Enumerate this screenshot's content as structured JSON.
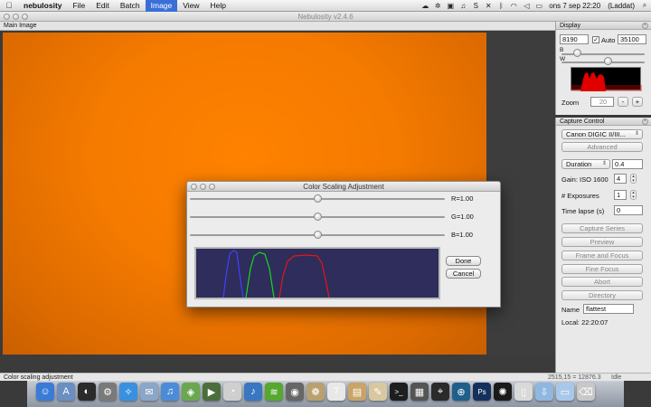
{
  "menubar": {
    "apple": "",
    "items": [
      "nebulosity",
      "File",
      "Edit",
      "Batch",
      "Image",
      "View",
      "Help"
    ],
    "active_index": 4,
    "clock": "ons 7 sep  22:20",
    "battery": "(Laddat)",
    "tray_icons": [
      "cloud-icon",
      "gear-icon",
      "square-icon",
      "headphones-icon",
      "skype-icon",
      "x-icon",
      "bluetooth-icon",
      "wifi-icon",
      "volume-icon",
      "battery-icon",
      "search-icon"
    ]
  },
  "window": {
    "title": "Nebulosity v2.4.6"
  },
  "main": {
    "pane_title": "Main Image",
    "image_color": "#ff8200"
  },
  "status": {
    "left": "Color scaling adjustment",
    "coords": "2515,15 = 12876.3",
    "state": "Idle"
  },
  "display": {
    "title": "Display",
    "black_value": "8190",
    "white_value": "35100",
    "auto_label": "Auto",
    "auto_checked": true,
    "b_label": "B",
    "w_label": "W",
    "b_slider": 0.18,
    "w_slider": 0.55,
    "zoom_label": "Zoom",
    "zoom_value": "20",
    "zoom_minus": "-",
    "zoom_plus": "+"
  },
  "capture": {
    "title": "Capture Control",
    "camera": "Canon DIGIC II/III...",
    "advanced": "Advanced",
    "duration_select": "Duration",
    "duration_value": "0.4",
    "gain_label": "Gain: ISO 1600",
    "gain_value": "4",
    "exposures_label": "# Exposures",
    "exposures_value": "1",
    "timelapse_label": "Time lapse (s)",
    "timelapse_value": "0",
    "buttons": [
      "Capture Series",
      "Preview",
      "Frame and Focus",
      "Fine Focus",
      "Abort",
      "Directory"
    ],
    "name_label": "Name",
    "name_value": "flattest",
    "local_time": "Local: 22:20:07"
  },
  "dialog": {
    "title": "Color Scaling Adjustment",
    "sliders": [
      {
        "label": "R=1.00",
        "value": 0.5
      },
      {
        "label": "G=1.00",
        "value": 0.5
      },
      {
        "label": "B=1.00",
        "value": 0.5
      }
    ],
    "done": "Done",
    "cancel": "Cancel"
  },
  "dock": {
    "icons": [
      {
        "name": "finder-icon",
        "color": "#3b7bd8",
        "glyph": "☺"
      },
      {
        "name": "app-store-icon",
        "color": "#6a8fc0",
        "glyph": "A"
      },
      {
        "name": "dashboard-icon",
        "color": "#2b2b2b",
        "glyph": "◐"
      },
      {
        "name": "system-preferences-icon",
        "color": "#7a7a7a",
        "glyph": "⚙"
      },
      {
        "name": "safari-icon",
        "color": "#3a90e0",
        "glyph": "✧"
      },
      {
        "name": "mail-icon",
        "color": "#8aa6c8",
        "glyph": "✉"
      },
      {
        "name": "itunes-icon",
        "color": "#4b8cd8",
        "glyph": "♫"
      },
      {
        "name": "android-icon",
        "color": "#6aa84f",
        "glyph": "◈"
      },
      {
        "name": "facetime-icon",
        "color": "#4a6f3a",
        "glyph": "▶"
      },
      {
        "name": "clock-icon",
        "color": "#cfcfcf",
        "glyph": "◔"
      },
      {
        "name": "music-icon",
        "color": "#3a77c0",
        "glyph": "♪"
      },
      {
        "name": "spotify-icon",
        "color": "#56a82f",
        "glyph": "≋"
      },
      {
        "name": "camera-icon",
        "color": "#666666",
        "glyph": "◉"
      },
      {
        "name": "photo-icon",
        "color": "#b8a070",
        "glyph": "❁"
      },
      {
        "name": "calendar-icon",
        "color": "#e8e8e8",
        "glyph": "7"
      },
      {
        "name": "book-icon",
        "color": "#c9a467",
        "glyph": "▤"
      },
      {
        "name": "notes-icon",
        "color": "#d8c8a0",
        "glyph": "✎"
      },
      {
        "name": "terminal-icon",
        "color": "#1e1e1e",
        "glyph": ">_"
      },
      {
        "name": "calculator-icon",
        "color": "#555555",
        "glyph": "▦"
      },
      {
        "name": "telescope-icon",
        "color": "#2b2b2b",
        "glyph": "⌖"
      },
      {
        "name": "network-icon",
        "color": "#1f5f8b",
        "glyph": "⊕"
      },
      {
        "name": "photoshop-icon",
        "color": "#15305c",
        "glyph": "Ps"
      },
      {
        "name": "nebulosity-icon",
        "color": "#1a1a1a",
        "glyph": "✺"
      },
      {
        "name": "document-icon",
        "color": "#d9d9d9",
        "glyph": "▯"
      },
      {
        "name": "downloads-folder-icon",
        "color": "#8fb7e0",
        "glyph": "⇩"
      },
      {
        "name": "documents-folder-icon",
        "color": "#a8c8ea",
        "glyph": "▭"
      },
      {
        "name": "trash-icon",
        "color": "#c8c8c8",
        "glyph": "⌫"
      }
    ]
  }
}
